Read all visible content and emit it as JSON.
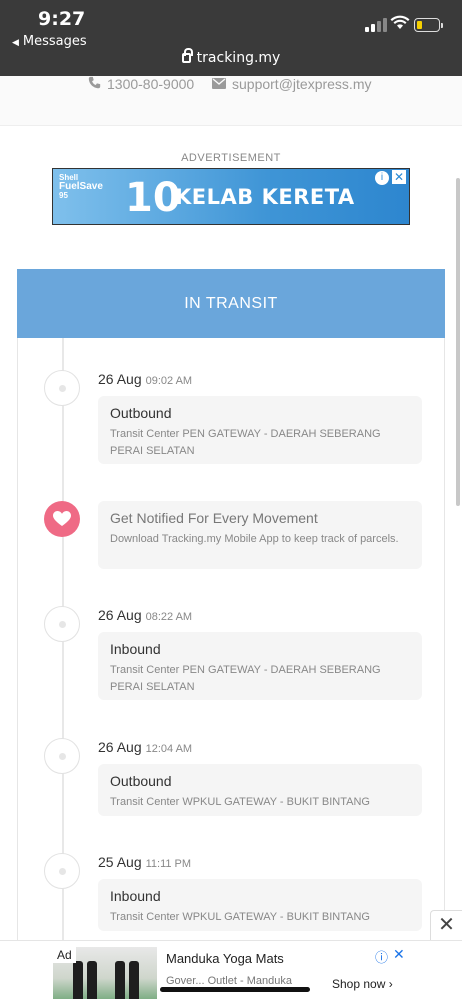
{
  "status_bar": {
    "time": "9:27",
    "back_label": "Messages",
    "url": "tracking.my"
  },
  "contact": {
    "phone": "1300-80-9000",
    "email": "support@jtexpress.my"
  },
  "ad_top": {
    "label": "ADVERTISEMENT",
    "brand_line1": "Shell",
    "brand_line2": "FuelSave",
    "brand_line3": "95",
    "number": "10",
    "headline": "KELAB KERETA"
  },
  "tracking": {
    "status": "IN TRANSIT",
    "events": [
      {
        "date": "26 Aug",
        "time": "09:02 AM",
        "title": "Outbound",
        "detail": "Transit Center PEN GATEWAY - DAERAH SEBERANG PERAI SELATAN"
      },
      {
        "date": "26 Aug",
        "time": "08:22 AM",
        "title": "Inbound",
        "detail": "Transit Center PEN GATEWAY - DAERAH SEBERANG PERAI SELATAN"
      },
      {
        "date": "26 Aug",
        "time": "12:04 AM",
        "title": "Outbound",
        "detail": "Transit Center WPKUL GATEWAY - BUKIT BINTANG"
      },
      {
        "date": "25 Aug",
        "time": "11:11 PM",
        "title": "Inbound",
        "detail": "Transit Center WPKUL GATEWAY - BUKIT BINTANG"
      }
    ],
    "notify": {
      "title": "Get Notified For Every Movement",
      "detail": "Download Tracking.my Mobile App to keep track of parcels."
    }
  },
  "bottom_ad": {
    "badge": "Ad",
    "title": "Manduka Yoga Mats",
    "subtitle": "Gover... Outlet - Manduka",
    "cta": "Shop now"
  },
  "icons": {
    "phone": "phone-icon",
    "mail": "mail-icon",
    "lock": "lock-icon",
    "heart": "heart-icon",
    "close": "close-icon"
  },
  "colors": {
    "status_header": "#6aa6db",
    "heart_node": "#ef6a85",
    "status_bar": "#3a3a3a"
  }
}
